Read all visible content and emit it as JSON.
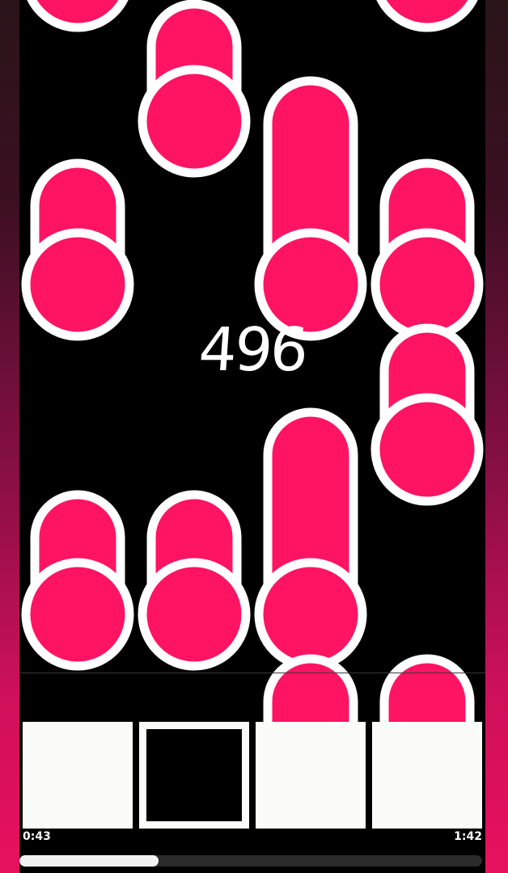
{
  "score": "496",
  "colors": {
    "note_fill": "#ff1464",
    "note_outline": "#ffffff",
    "playfield": "#000000",
    "pad": "#fbfbf9"
  },
  "lanes": [
    {
      "name": "lane-1",
      "pressed": false
    },
    {
      "name": "lane-2",
      "pressed": true
    },
    {
      "name": "lane-3",
      "pressed": false
    },
    {
      "name": "lane-4",
      "pressed": false
    }
  ],
  "playback": {
    "elapsed": "0:43",
    "total": "1:42",
    "progress": 0.3
  }
}
